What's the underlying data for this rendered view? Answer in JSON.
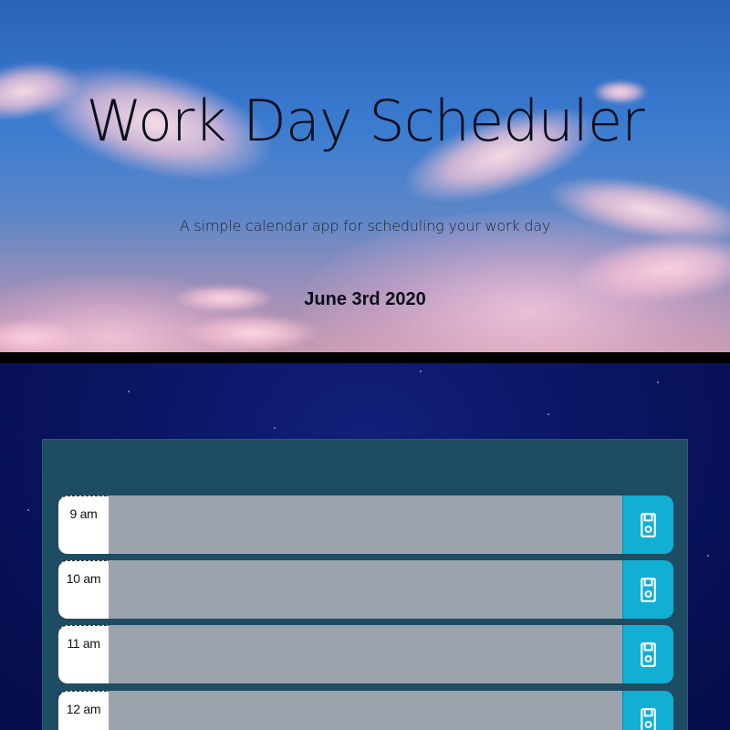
{
  "header": {
    "title": "Work Day Scheduler",
    "lead": "A simple calendar app for scheduling your work day",
    "current_date": "June 3rd 2020"
  },
  "schedule": {
    "time_blocks": [
      {
        "hour": "9 am",
        "description": ""
      },
      {
        "hour": "10 am",
        "description": ""
      },
      {
        "hour": "11 am",
        "description": ""
      },
      {
        "hour": "12 am",
        "description": ""
      }
    ],
    "save_icon": "floppy-disk-icon"
  },
  "colors": {
    "container": "#1e4c62",
    "hour_background": "#ffffff",
    "description_background": "#9ba4ad",
    "save_button": "#12afd4",
    "night_background": "#0b1666"
  }
}
